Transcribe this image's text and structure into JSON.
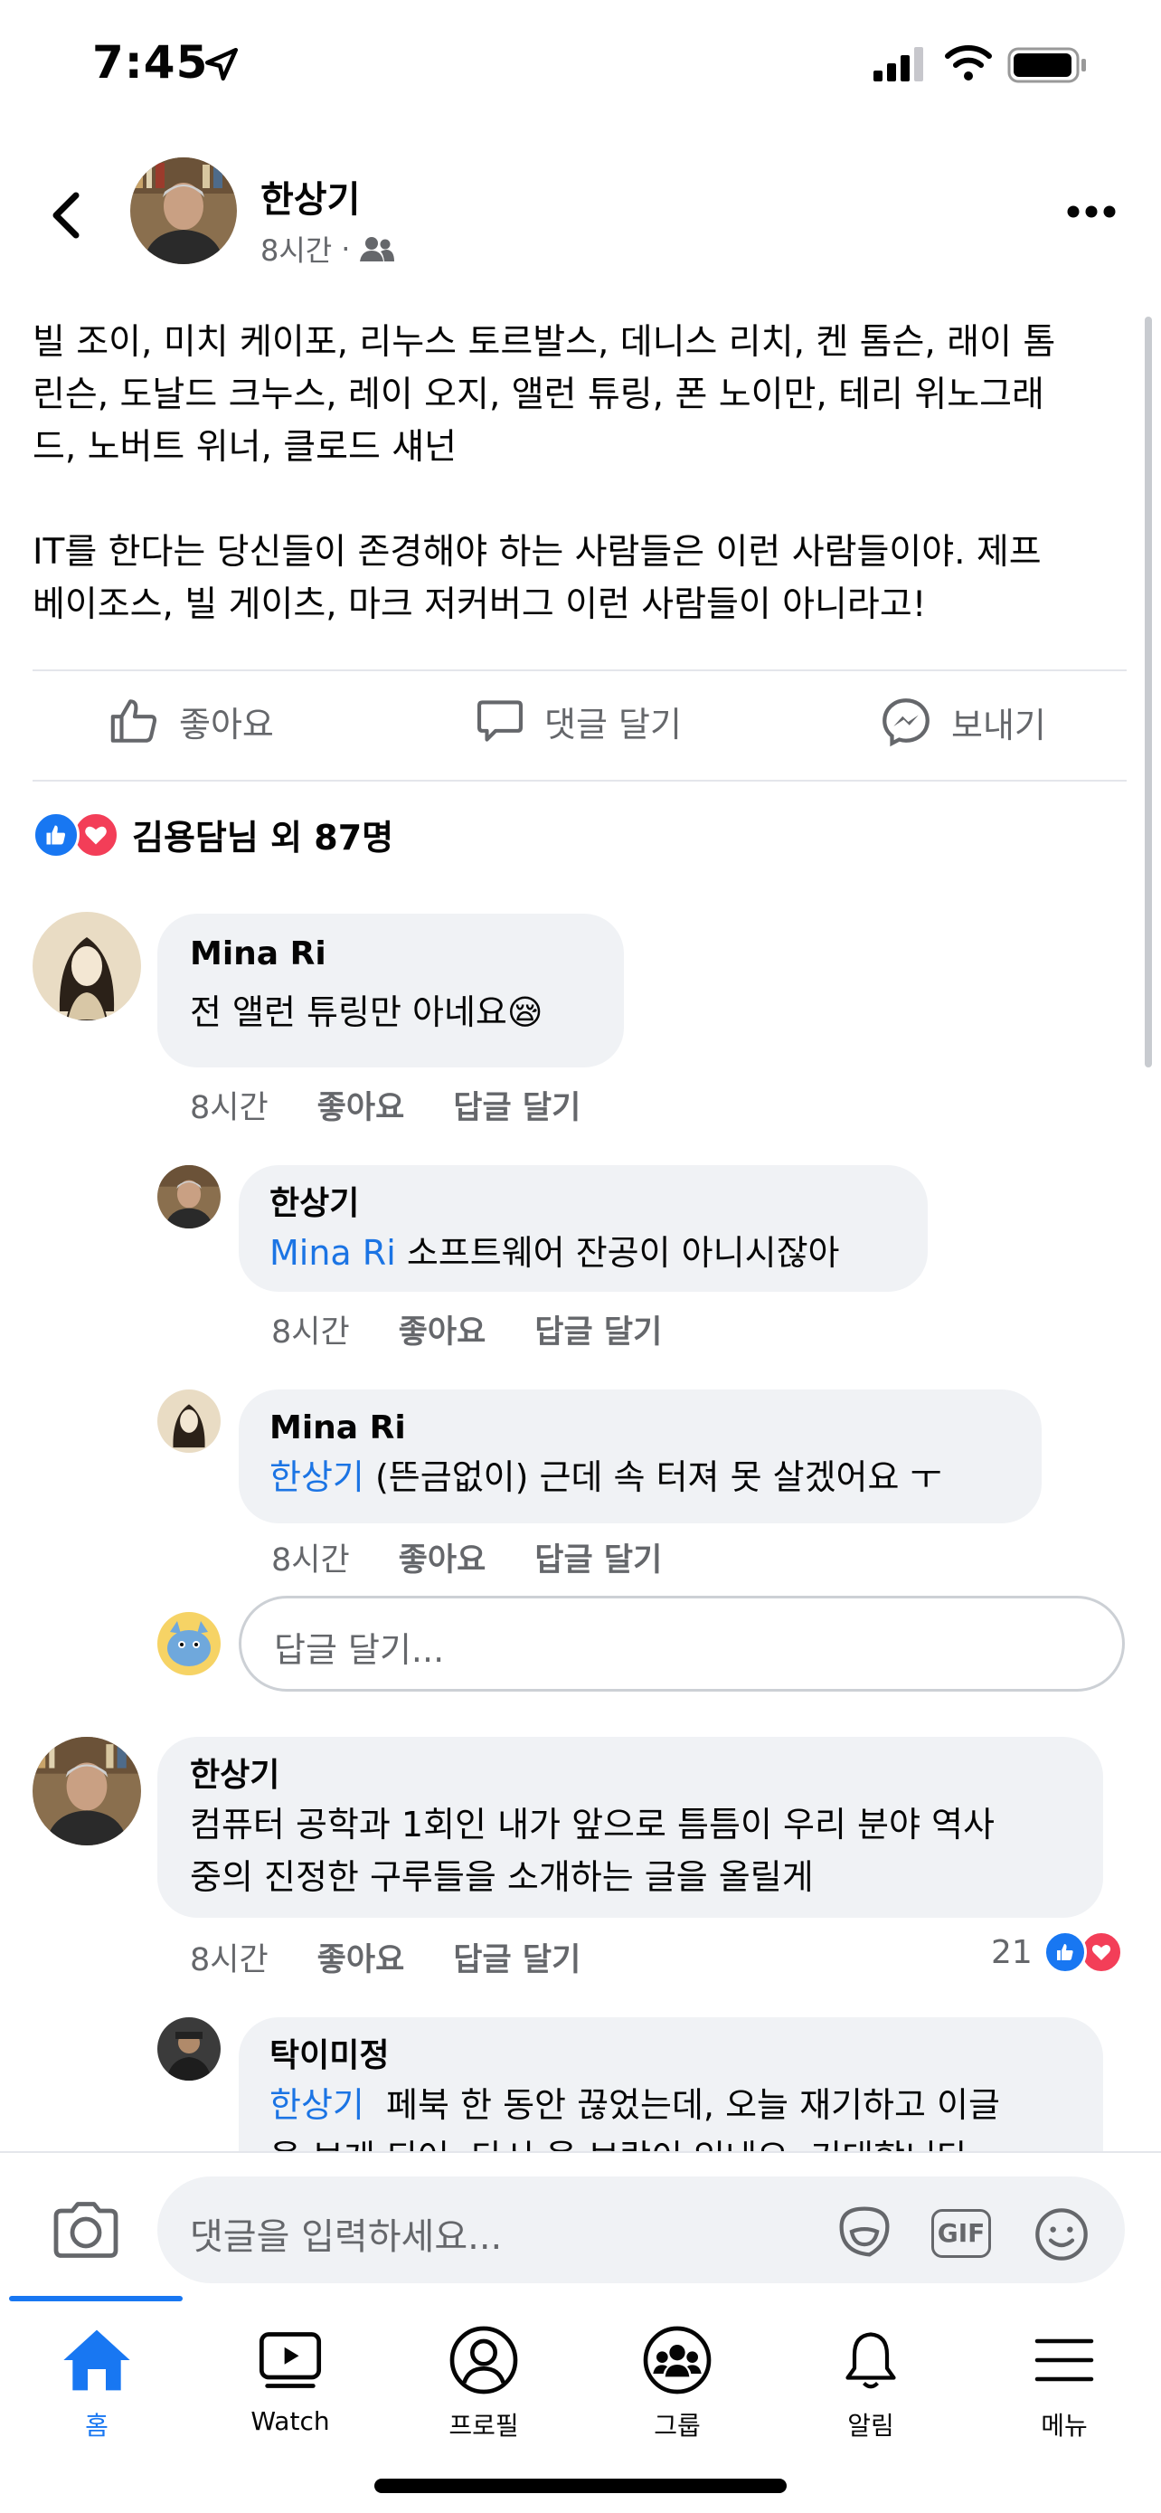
{
  "status_bar": {
    "time": "7:45"
  },
  "post": {
    "author": "한상기",
    "time": "8시간",
    "separator": "·",
    "body_p1": "빌 조이, 미치 케이포, 리누스 토르발스, 데니스 리치, 켄 톰슨, 래이 톰\n린슨, 도날드 크누스, 레이 오지, 앨런 튜링, 폰 노이만, 테리 위노그래\n드, 노버트 위너, 클로드 섀넌",
    "body_p2": "IT를 한다는 당신들이 존경해야 하는 사람들은 이런 사람들이야. 제프\n베이조스, 빌 게이츠, 마크 저커버그 이런 사람들이 아니라고!"
  },
  "actions": {
    "like": "좋아요",
    "comment": "댓글 달기",
    "send": "보내기"
  },
  "reactions": {
    "text": "김용담님 외 87명"
  },
  "comments": [
    {
      "name": "Mina Ri",
      "text": "전 앨런 튜링만 아네요😪",
      "time": "8시간",
      "like": "좋아요",
      "reply": "답글 달기"
    },
    {
      "name": "한상기",
      "mention": "Mina Ri",
      "text": " 소프트웨어 잔공이 아니시잖아",
      "time": "8시간",
      "like": "좋아요",
      "reply": "답글 달기"
    },
    {
      "name": "Mina Ri",
      "mention": "한상기",
      "text": " (뜬금없이) 근데 속 터져 못 살겠어요 ㅜ",
      "time": "8시간",
      "like": "좋아요",
      "reply": "답글 달기"
    },
    {
      "name": "한상기",
      "text": "컴퓨터 공학과 1회인 내가 앞으로 틈틈이 우리 분야 역사\n중의 진정한 구루들을 소개하는 글을 올릴게",
      "time": "8시간",
      "like": "좋아요",
      "reply": "답글 달기",
      "reaction_count": "21"
    },
    {
      "name": "탁이미정",
      "mention": "한상기",
      "text": "  페북 한 동안 끊었는데, 오늘 재기하고 이글\n을 보게 되어, 다시 올 보람이 있네요. 기대합니다"
    }
  ],
  "reply_input": {
    "placeholder": "답글 달기..."
  },
  "composer": {
    "placeholder": "댓글을 입력하세요...",
    "gif": "GIF"
  },
  "tabs": [
    {
      "label": "홈",
      "icon": "home-icon",
      "active": true
    },
    {
      "label": "Watch",
      "icon": "watch-icon"
    },
    {
      "label": "프로필",
      "icon": "profile-icon"
    },
    {
      "label": "그룹",
      "icon": "groups-icon"
    },
    {
      "label": "알림",
      "icon": "bell-icon"
    },
    {
      "label": "메뉴",
      "icon": "menu-icon"
    }
  ],
  "colors": {
    "accent": "#1877f2",
    "mention": "#1b74e4",
    "bubble": "#f0f2f5",
    "secondary_text": "#65676b"
  }
}
